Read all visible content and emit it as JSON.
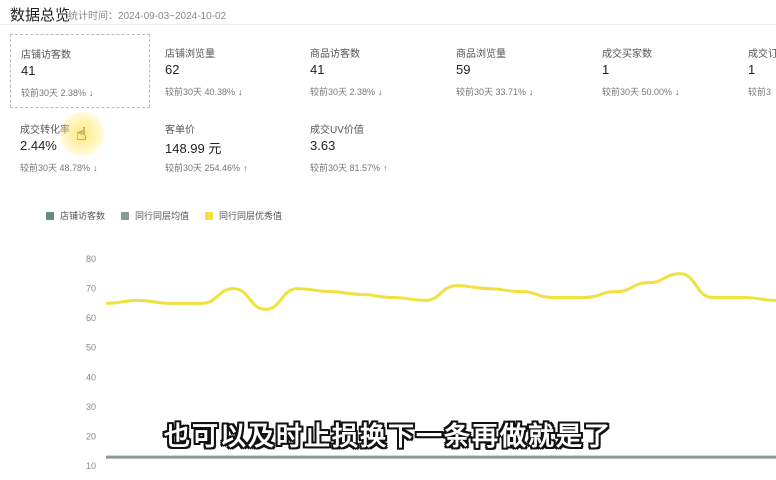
{
  "header": {
    "title": "数据总览",
    "range": "统计时间：2024-09-03~2024-10-02"
  },
  "metrics": [
    {
      "label": "店铺访客数",
      "value": "41",
      "cmp": "较前30天  2.38%",
      "trend": "down",
      "selected": true
    },
    {
      "label": "店铺浏览量",
      "value": "62",
      "cmp": "较前30天  40.38%",
      "trend": "down"
    },
    {
      "label": "商品访客数",
      "value": "41",
      "cmp": "较前30天  2.38%",
      "trend": "down"
    },
    {
      "label": "商品浏览量",
      "value": "59",
      "cmp": "较前30天  33.71%",
      "trend": "down"
    },
    {
      "label": "成交买家数",
      "value": "1",
      "cmp": "较前30天  50.00%",
      "trend": "down"
    },
    {
      "label": "成交订",
      "value": "1",
      "cmp": "较前3",
      "trend": "none"
    },
    {
      "label": "成交转化率",
      "value": "2.44%",
      "cmp": "较前30天  48.78%",
      "trend": "down"
    },
    {
      "label": "客单价",
      "value": "148.99 元",
      "cmp": "较前30天  254.46%",
      "trend": "up"
    },
    {
      "label": "成交UV价值",
      "value": "3.63",
      "cmp": "较前30天  81.57%",
      "trend": "up"
    }
  ],
  "legend": [
    {
      "label": "店铺访客数",
      "color": "#6b8a7a"
    },
    {
      "label": "同行同层均值",
      "color": "#8a9a90"
    },
    {
      "label": "同行同层优秀值",
      "color": "#f0e040"
    }
  ],
  "chart_data": {
    "type": "line",
    "y_ticks": [
      "80",
      "70",
      "60",
      "50",
      "40",
      "30",
      "20",
      "10"
    ],
    "ylim": [
      10,
      80
    ],
    "series": [
      {
        "name": "同行同层优秀值",
        "color": "#f0e040",
        "values": [
          65,
          66,
          65,
          65,
          70,
          63,
          70,
          69,
          68,
          67,
          66,
          71,
          70,
          69,
          67,
          67,
          69,
          72,
          75,
          67,
          67,
          66
        ]
      },
      {
        "name": "同行同层均值",
        "color": "#8a9a90",
        "values": [
          13,
          13,
          13,
          13,
          13,
          13,
          13,
          13,
          13,
          13,
          13,
          13,
          13,
          13,
          13,
          13,
          13,
          13,
          13,
          13,
          13,
          13
        ]
      }
    ]
  },
  "subtitle": "也可以及时止损换下一条再做就是了"
}
